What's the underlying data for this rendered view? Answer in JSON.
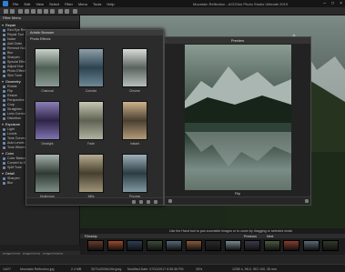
{
  "titlebar": {
    "menus": [
      "File",
      "Edit",
      "View",
      "Select",
      "Filter",
      "Menu",
      "Tools",
      "Help"
    ],
    "title": "Mountain Reflection - ACDSee Photo Studio Ultimate 2019"
  },
  "left_panel": {
    "header": "Filter Menu",
    "sections": [
      {
        "label": "Repair",
        "items": [
          "Red Eye Reduction",
          "Repair Tool",
          "Noise",
          "Add Grain",
          "Remove Noise",
          "Blur",
          "Sharpen",
          "Special Effect",
          "Adjust Hue",
          "Photo Effects",
          "Skin Tune"
        ]
      },
      {
        "label": "Geometry",
        "items": [
          "Rotate",
          "Flip",
          "Resize",
          "Perspective",
          "Crop",
          "Straighten",
          "Lens Correction",
          "Distortion"
        ]
      },
      {
        "label": "Exposure",
        "items": [
          "Light",
          "Levels",
          "Tone Curves",
          "Auto Levels",
          "Tone Wheels"
        ]
      },
      {
        "label": "Color",
        "items": [
          "Color Balance",
          "Convert to Black & White",
          "Split Tone"
        ]
      },
      {
        "label": "Detail",
        "items": [
          "Sharpen",
          "Blur"
        ]
      }
    ],
    "buttons": [
      "Save",
      "Done",
      "Cancel"
    ]
  },
  "dialog": {
    "title": "Artistic Browser",
    "subtitle": "Photo Effects",
    "thumbs": [
      "Charcoal",
      "Colorize",
      "Chrome",
      "Dewlight",
      "Fade",
      "Instant",
      "Mushroom",
      "Mills",
      "Process"
    ]
  },
  "preview": {
    "title": "Preview",
    "label": "Flip"
  },
  "hint": "Use the Hand tool to pan zoomable images or to zoom by dragging or selected mode",
  "filmstrip": {
    "label": "Filmstrip",
    "nav": [
      "Previous",
      "Next"
    ],
    "count": 13
  },
  "status": {
    "index": "14/27",
    "filename": "Mountain Reflection.jpg",
    "size": "2.4 MB",
    "dims": "3072x2049x24b jpeg",
    "modified": "Modified Date: 07/31/2017 6:55:36 PM",
    "zoom": "26%",
    "info": "1/250 s, f/8.0, ISO 100, 35 mm"
  },
  "colors": {
    "accent": "#2f7fd6",
    "panel": "#252525",
    "dark": "#1a1a1a"
  }
}
